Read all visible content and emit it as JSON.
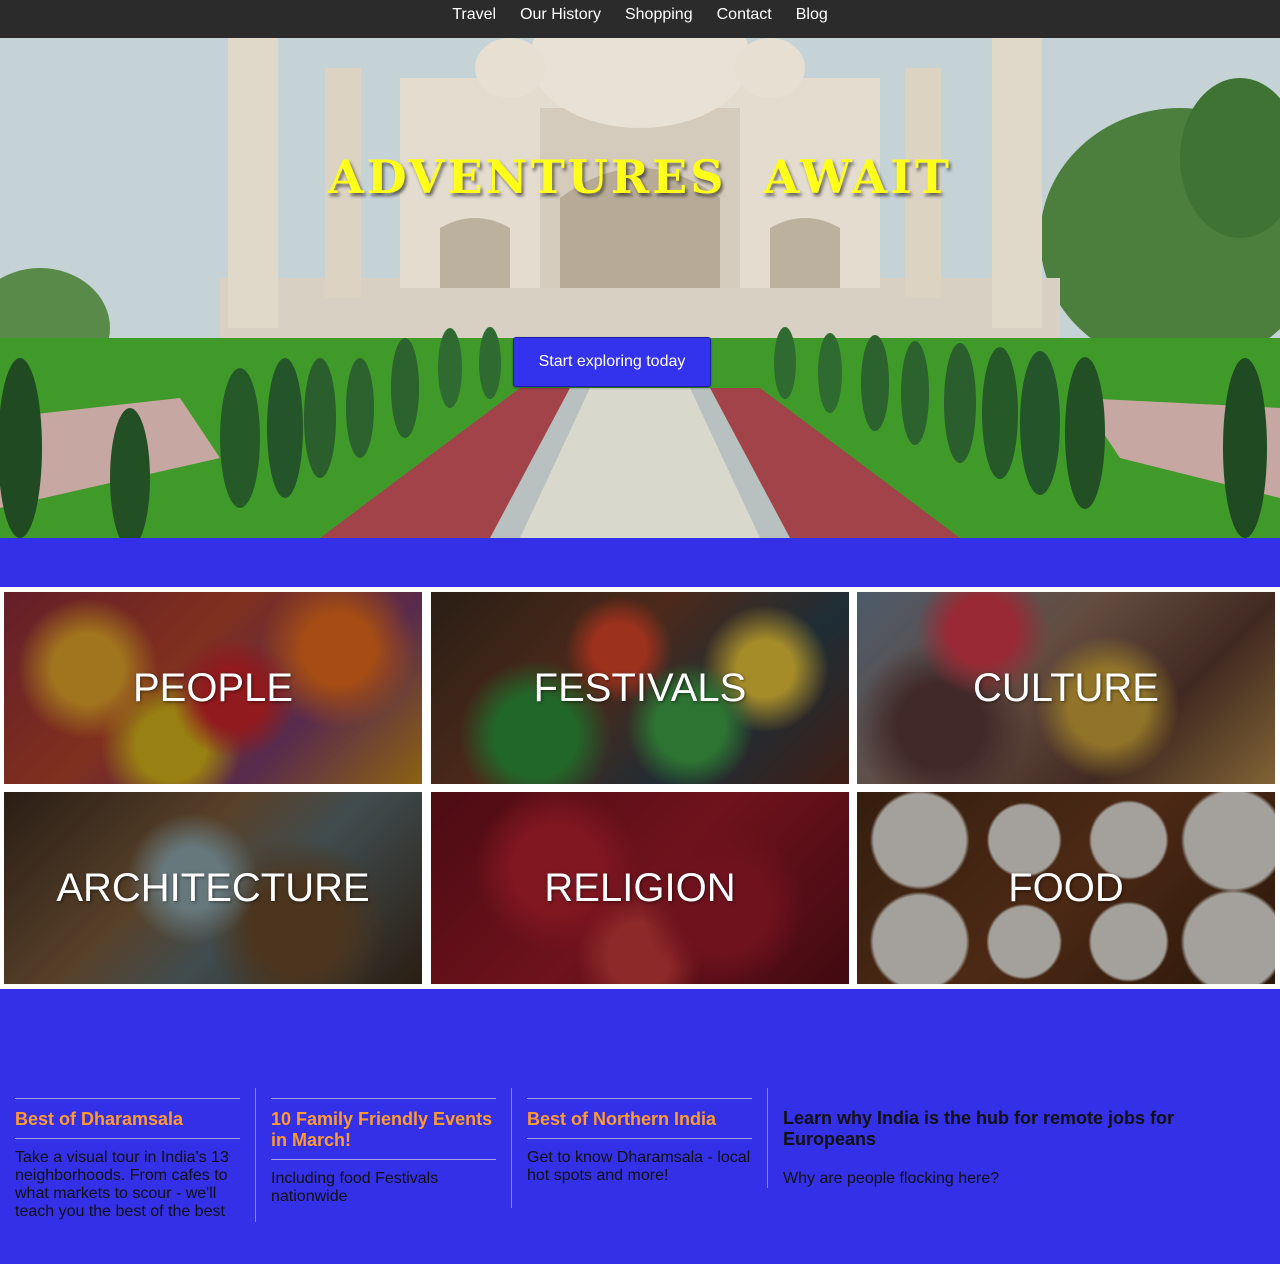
{
  "nav": {
    "items": [
      "Travel",
      "Our History",
      "Shopping",
      "Contact",
      "Blog"
    ]
  },
  "hero": {
    "title": "ADVENTURES AWAIT",
    "cta_label": "Start exploring today"
  },
  "tiles": [
    {
      "label": "PEOPLE"
    },
    {
      "label": "FESTIVALS"
    },
    {
      "label": "CULTURE"
    },
    {
      "label": "ARCHITECTURE"
    },
    {
      "label": "RELIGION"
    },
    {
      "label": "FOOD"
    }
  ],
  "articles": [
    {
      "title": "Best of Dharamsala",
      "text": "Take a visual tour in India's 13 neighborhoods. From cafes to what markets to scour - we'll teach you the best of the best"
    },
    {
      "title": "10 Family Friendly Events in March!",
      "text": "Including food Festivals nationwide"
    },
    {
      "title": "Best of Northern India",
      "text": "Get to know Dharamsala - local hot spots and more!"
    },
    {
      "title": "Learn why India is the hub for remote jobs for Europeans",
      "text": "Why are people flocking here?"
    }
  ],
  "colors": {
    "nav_bg": "#2b2b2b",
    "page_bg": "#3330e8",
    "hero_title": "#ffff1a",
    "article_title": "#ff9a2e",
    "button_bg": "#3333ee"
  }
}
